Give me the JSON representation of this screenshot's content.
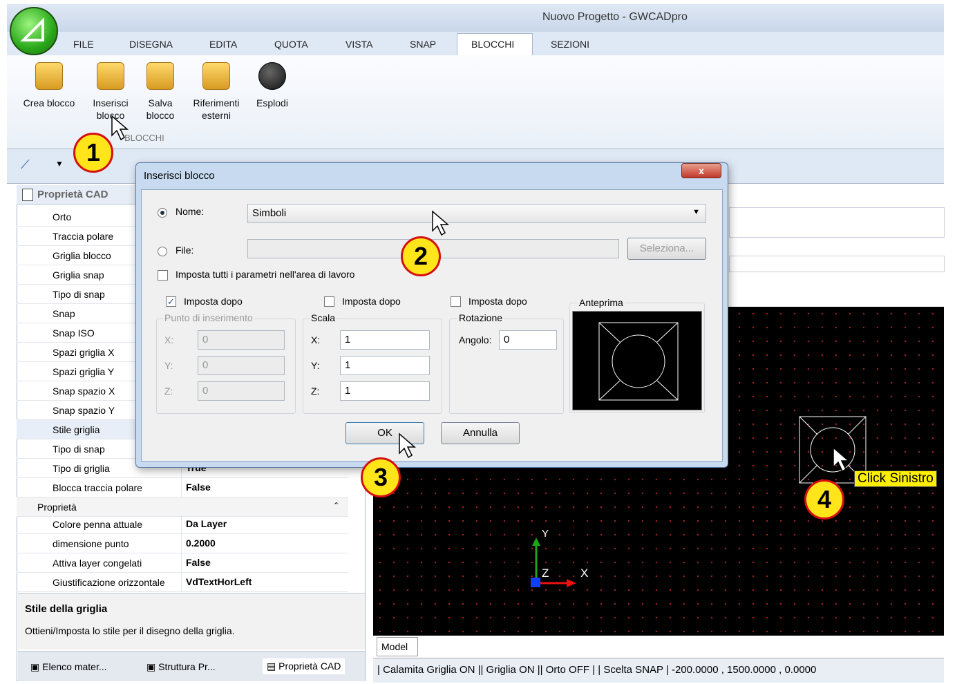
{
  "window": {
    "title": "Nuovo Progetto - GWCADpro"
  },
  "ribbon": {
    "tabs": [
      "FILE",
      "DISEGNA",
      "EDITA",
      "QUOTA",
      "VISTA",
      "SNAP",
      "BLOCCHI",
      "SEZIONI"
    ],
    "active_tab": "BLOCCHI",
    "buttons": [
      {
        "l1": "Crea blocco",
        "l2": ""
      },
      {
        "l1": "Inserisci",
        "l2": "blocco"
      },
      {
        "l1": "Salva",
        "l2": "blocco"
      },
      {
        "l1": "Riferimenti",
        "l2": "esterni"
      },
      {
        "l1": "Esplodi",
        "l2": ""
      }
    ],
    "group_label": "BLOCCHI"
  },
  "panel": {
    "title": "Proprietà CAD",
    "rows": [
      {
        "label": "Orto",
        "value": ""
      },
      {
        "label": "Traccia polare",
        "value": ""
      },
      {
        "label": "Griglia blocco",
        "value": ""
      },
      {
        "label": "Griglia snap",
        "value": ""
      },
      {
        "label": "Tipo di snap",
        "value": ""
      },
      {
        "label": "Snap",
        "value": ""
      },
      {
        "label": "Snap ISO",
        "value": ""
      },
      {
        "label": "Spazi griglia X",
        "value": ""
      },
      {
        "label": "Spazi griglia Y",
        "value": ""
      },
      {
        "label": "Snap spazio X",
        "value": ""
      },
      {
        "label": "Snap spazio Y",
        "value": ""
      },
      {
        "label": "Stile griglia",
        "value": ""
      },
      {
        "label": "Tipo di snap",
        "value": ""
      },
      {
        "label": "Tipo di griglia",
        "value": "True"
      },
      {
        "label": "Blocca traccia polare",
        "value": "False"
      }
    ],
    "section": "Proprietà",
    "rows2": [
      {
        "label": "Colore penna attuale",
        "value": "Da Layer"
      },
      {
        "label": "dimensione punto",
        "value": "0.2000"
      },
      {
        "label": "Attiva layer congelati",
        "value": "False"
      },
      {
        "label": "Giustificazione orizzontale",
        "value": "VdTextHorLeft"
      }
    ],
    "desc_title": "Stile della griglia",
    "desc_text": "Ottieni/Imposta lo stile per il disegno della griglia.",
    "bottom_tabs": [
      "Elenco mater...",
      "Struttura Pr...",
      "Proprietà CAD"
    ]
  },
  "dialog": {
    "title": "Inserisci blocco",
    "close": "x",
    "name_label": "Nome:",
    "name_value": "Simboli",
    "file_label": "File:",
    "file_value": "",
    "select_button": "Seleziona...",
    "set_all_label": "Imposta tutti i parametri nell'area di lavoro",
    "set_after": "Imposta dopo",
    "insert_group": "Punto di inserimento",
    "insert": {
      "x_label": "X:",
      "y_label": "Y:",
      "z_label": "Z:",
      "x": "0",
      "y": "0",
      "z": "0"
    },
    "scale_group": "Scala",
    "scale": {
      "x_label": "X:",
      "y_label": "Y:",
      "z_label": "Z:",
      "x": "1",
      "y": "1",
      "z": "1"
    },
    "rotation_group": "Rotazione",
    "angle_label": "Angolo:",
    "angle_value": "0",
    "preview_label": "Anteprima",
    "ok": "OK",
    "cancel": "Annulla"
  },
  "canvas": {
    "model_tab": "Model",
    "axis_x": "X",
    "axis_y": "Y",
    "axis_z": "Z"
  },
  "status": {
    "text": "| Calamita Griglia ON || Griglia ON || Orto OFF | | Scelta SNAP |    -200.0000 , 1500.0000 , 0.0000"
  },
  "annotations": {
    "n1": "1",
    "n2": "2",
    "n3": "3",
    "n4": "4",
    "click_label": "Click Sinistro"
  }
}
